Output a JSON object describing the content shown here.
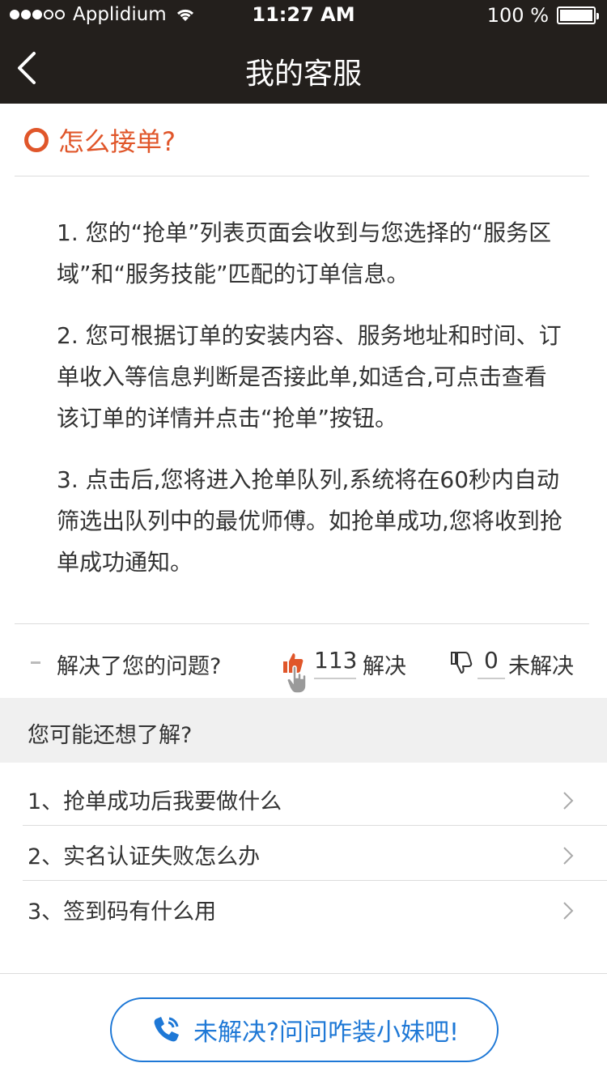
{
  "status": {
    "carrier": "Applidium",
    "time": "11:27 AM",
    "battery": "100 %"
  },
  "nav": {
    "title": "我的客服"
  },
  "question": {
    "title": "怎么接单?",
    "paragraphs": [
      "1. 您的“抢单”列表页面会收到与您选择的“服务区域”和“服务技能”匹配的订单信息。",
      "2. 您可根据订单的安装内容、服务地址和时间、订单收入等信息判断是否接此单,如适合,可点击查看该订单的详情并点击“抢单”按钮。",
      "3. 点击后,您将进入抢单队列,系统将在60秒内自动筛选出队列中的最优师傅。如抢单成功,您将收到抢单成功通知。"
    ]
  },
  "feedback": {
    "prompt": "解决了您的问题?",
    "solved_count": "113",
    "solved_label": "解决",
    "unsolved_count": "0",
    "unsolved_label": "未解决"
  },
  "related": {
    "title": "您可能还想了解?",
    "items": [
      {
        "label": "1、抢单成功后我要做什么"
      },
      {
        "label": "2、实名认证失败怎么办"
      },
      {
        "label": "3、签到码有什么用"
      }
    ]
  },
  "cta": {
    "label": "未解决?问问咋装小妹吧!"
  },
  "colors": {
    "accent": "#e0562a",
    "link": "#1e78d6",
    "nav_bg": "#231f1c"
  }
}
